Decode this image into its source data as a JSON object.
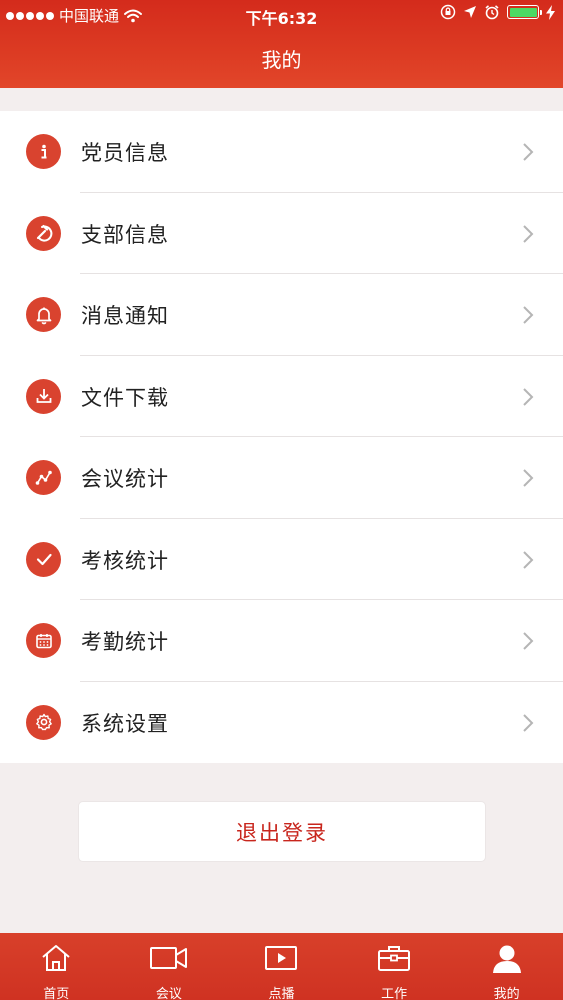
{
  "status_bar": {
    "carrier": "中国联通",
    "time": "下午6:32"
  },
  "nav": {
    "title": "我的"
  },
  "menu": [
    {
      "label": "党员信息",
      "icon": "info-icon"
    },
    {
      "label": "支部信息",
      "icon": "party-emblem-icon"
    },
    {
      "label": "消息通知",
      "icon": "bell-icon"
    },
    {
      "label": "文件下载",
      "icon": "download-icon"
    },
    {
      "label": "会议统计",
      "icon": "line-chart-icon"
    },
    {
      "label": "考核统计",
      "icon": "check-icon"
    },
    {
      "label": "考勤统计",
      "icon": "calendar-icon"
    },
    {
      "label": "系统设置",
      "icon": "gear-icon"
    }
  ],
  "logout": {
    "label": "退出登录"
  },
  "tabs": [
    {
      "label": "首页",
      "icon": "home-icon"
    },
    {
      "label": "会议",
      "icon": "video-camera-icon"
    },
    {
      "label": "点播",
      "icon": "play-icon"
    },
    {
      "label": "工作",
      "icon": "briefcase-icon"
    },
    {
      "label": "我的",
      "icon": "person-icon",
      "active": true
    }
  ],
  "colors": {
    "brand_red": "#d42b1c",
    "icon_red": "#d9432f",
    "logout_text": "#c8261d",
    "battery_green": "#4cd964"
  }
}
